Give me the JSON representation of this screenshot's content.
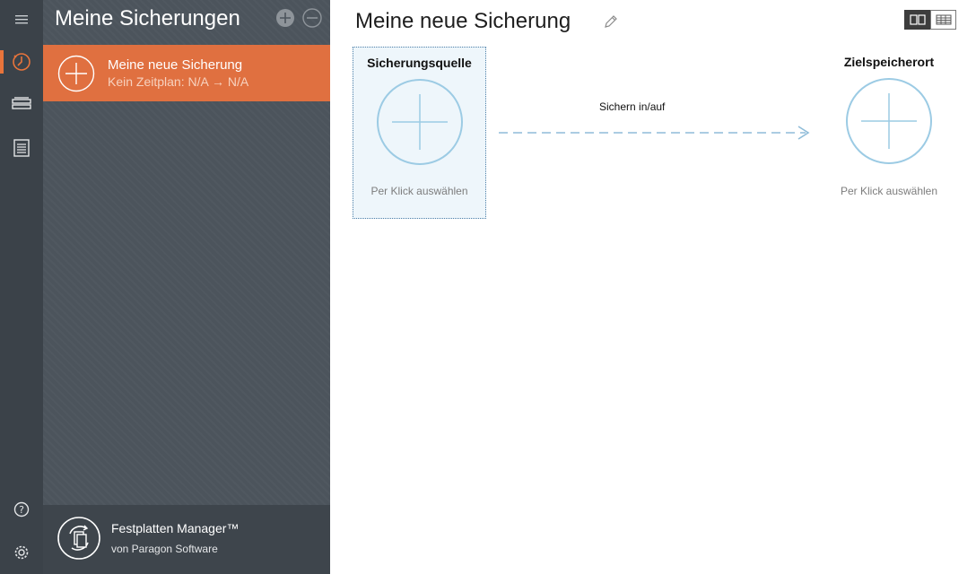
{
  "sidebar": {
    "panel_title": "Meine Sicherungen",
    "items": [
      {
        "title": "Meine neue Sicherung",
        "subtitle": "Kein Zeitplan: N/A → N/A"
      }
    ],
    "brand": {
      "name": "Festplatten Manager™",
      "vendor": "von Paragon Software"
    }
  },
  "main": {
    "title": "Meine neue Sicherung",
    "source": {
      "label": "Sicherungsquelle",
      "hint": "Per Klick auswählen"
    },
    "flow_label": "Sichern in/auf",
    "destination": {
      "label": "Zielspeicherort",
      "hint": "Per Klick auswählen"
    }
  },
  "colors": {
    "accent": "#e07040",
    "rail": "#3b4249",
    "panel": "#4c545c",
    "circle": "#9ccbe4",
    "arrow": "#8fbcd8"
  }
}
